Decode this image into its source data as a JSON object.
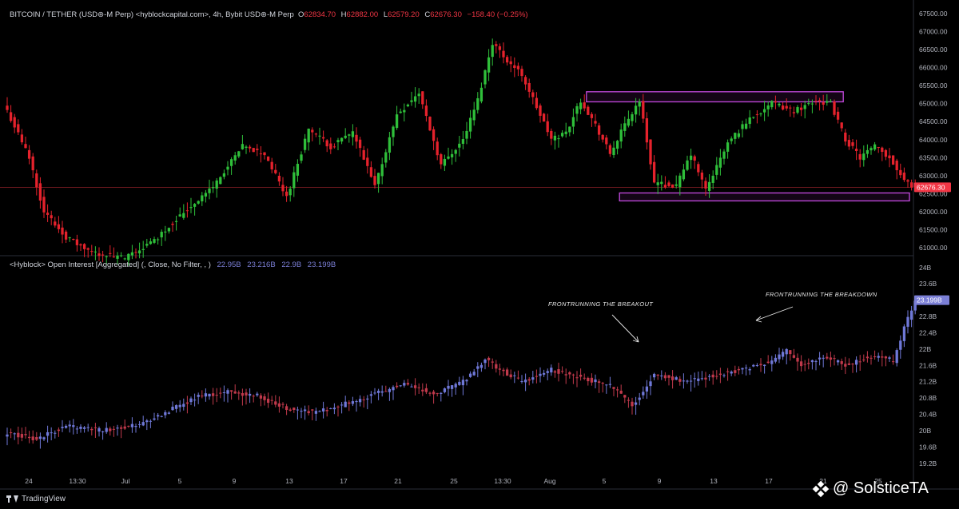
{
  "header": {
    "symbol": "BITCOIN / TETHER (USD⊛-M Perp) <hyblockcapital.com>, 4h, Bybit USD⊛-M Perp",
    "o_label": "O",
    "o": "62834.70",
    "h_label": "H",
    "h": "62882.00",
    "l_label": "L",
    "l": "62579.20",
    "c_label": "C",
    "c": "62676.30",
    "change": "−158.40 (−0.25%)"
  },
  "indicator": {
    "title": "<Hyblock> Open Interest [Aggregated] (, Close, No Filter, , )",
    "values": [
      "22.95B",
      "23.216B",
      "22.9B",
      "23.199B"
    ]
  },
  "annotations": {
    "breakout": "FRONTRUNNING THE BREAKOUT",
    "breakdown": "FRONTRUNNING THE BREAKDOWN"
  },
  "footer": {
    "brand": "TradingView"
  },
  "watermark": "@ SolsticeTA",
  "colors": {
    "up": "#26a69a",
    "up_bright": "#2fbf3a",
    "down": "#e5222c",
    "oi_up": "#6f78d8",
    "oi_down": "#c0394b",
    "zone": "#c54ae0",
    "price_tag": "#f23645",
    "oi_tag": "#7b7fd6"
  },
  "chart_data": [
    {
      "type": "candlestick",
      "title": "BITCOIN / TETHER (USD⊛-M Perp), 4h",
      "price_axis": [
        "67500.00",
        "67000.00",
        "66500.00",
        "66000.00",
        "65500.00",
        "65000.00",
        "64500.00",
        "64000.00",
        "63500.00",
        "63000.00",
        "62500.00",
        "62000.00",
        "61500.00",
        "61000.00"
      ],
      "ylim": [
        60800,
        67700
      ],
      "x_ticks": [
        "24",
        "13:30",
        "Jul",
        "5",
        "9",
        "13",
        "17",
        "21",
        "25",
        "13:30",
        "Aug",
        "5",
        "9",
        "13",
        "17",
        "21",
        "25"
      ],
      "last_price": "62676.30",
      "anchors": [
        [
          0,
          64800
        ],
        [
          6,
          63500
        ],
        [
          10,
          62000
        ],
        [
          16,
          61300
        ],
        [
          22,
          60900
        ],
        [
          32,
          60700
        ],
        [
          40,
          61200
        ],
        [
          46,
          61800
        ],
        [
          56,
          62700
        ],
        [
          64,
          63800
        ],
        [
          70,
          63600
        ],
        [
          76,
          62400
        ],
        [
          82,
          64300
        ],
        [
          88,
          63800
        ],
        [
          94,
          64200
        ],
        [
          100,
          62700
        ],
        [
          106,
          64700
        ],
        [
          112,
          65300
        ],
        [
          118,
          63300
        ],
        [
          124,
          64000
        ],
        [
          128,
          65100
        ],
        [
          132,
          66700
        ],
        [
          136,
          66200
        ],
        [
          140,
          65800
        ],
        [
          144,
          64900
        ],
        [
          148,
          64000
        ],
        [
          152,
          64200
        ],
        [
          156,
          65100
        ],
        [
          160,
          64400
        ],
        [
          164,
          63600
        ],
        [
          168,
          64400
        ],
        [
          172,
          65100
        ],
        [
          176,
          62800
        ],
        [
          182,
          62700
        ],
        [
          186,
          63600
        ],
        [
          190,
          62600
        ],
        [
          196,
          63900
        ],
        [
          202,
          64600
        ],
        [
          208,
          65000
        ],
        [
          214,
          64800
        ],
        [
          220,
          65100
        ],
        [
          224,
          65000
        ],
        [
          228,
          64000
        ],
        [
          232,
          63500
        ],
        [
          236,
          63800
        ],
        [
          240,
          63500
        ],
        [
          244,
          62900
        ],
        [
          247,
          62650
        ]
      ],
      "zones": [
        {
          "label": "resistance",
          "from_index": 158,
          "to_index": 227,
          "low": 65050,
          "high": 65330
        },
        {
          "label": "support",
          "from_index": 167,
          "to_index": 245,
          "low": 62300,
          "high": 62520
        }
      ]
    },
    {
      "type": "candlestick",
      "title": "<Hyblock> Open Interest [Aggregated]",
      "axis": [
        "24B",
        "23.6B",
        "23.2B",
        "22.8B",
        "22.4B",
        "22B",
        "21.6B",
        "21.2B",
        "20.8B",
        "20.4B",
        "20B",
        "19.6B",
        "19.2B"
      ],
      "ylim": [
        19.0,
        24.25
      ],
      "last_value": "23.199B",
      "anchors": [
        [
          0,
          19.95
        ],
        [
          8,
          19.8
        ],
        [
          16,
          20.1
        ],
        [
          26,
          20.0
        ],
        [
          36,
          20.15
        ],
        [
          44,
          20.5
        ],
        [
          52,
          20.85
        ],
        [
          60,
          20.95
        ],
        [
          68,
          20.85
        ],
        [
          76,
          20.55
        ],
        [
          84,
          20.45
        ],
        [
          92,
          20.65
        ],
        [
          100,
          20.9
        ],
        [
          108,
          21.15
        ],
        [
          116,
          20.9
        ],
        [
          124,
          21.2
        ],
        [
          130,
          21.75
        ],
        [
          134,
          21.5
        ],
        [
          140,
          21.2
        ],
        [
          148,
          21.5
        ],
        [
          156,
          21.3
        ],
        [
          164,
          21.1
        ],
        [
          170,
          20.6
        ],
        [
          176,
          21.4
        ],
        [
          184,
          21.2
        ],
        [
          192,
          21.35
        ],
        [
          200,
          21.5
        ],
        [
          208,
          21.7
        ],
        [
          212,
          21.95
        ],
        [
          216,
          21.6
        ],
        [
          222,
          21.8
        ],
        [
          228,
          21.6
        ],
        [
          234,
          21.8
        ],
        [
          238,
          21.85
        ],
        [
          241,
          21.7
        ],
        [
          244,
          22.5
        ],
        [
          247,
          23.2
        ]
      ]
    }
  ]
}
